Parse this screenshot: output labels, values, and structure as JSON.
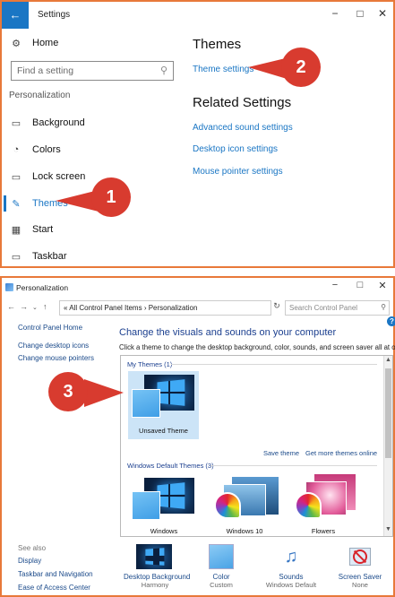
{
  "settings": {
    "title": "Settings",
    "back_glyph": "←",
    "controls": {
      "minimize": "−",
      "maximize": "□",
      "close": "✕"
    },
    "nav_home": "Home",
    "search_placeholder": "Find a setting",
    "section": "Personalization",
    "nav": [
      {
        "label": "Background",
        "icon": "image-icon"
      },
      {
        "label": "Colors",
        "icon": "palette-icon"
      },
      {
        "label": "Lock screen",
        "icon": "lock-screen-icon"
      },
      {
        "label": "Themes",
        "icon": "themes-icon"
      },
      {
        "label": "Start",
        "icon": "start-icon"
      },
      {
        "label": "Taskbar",
        "icon": "taskbar-icon"
      }
    ],
    "heading_themes": "Themes",
    "link_theme_settings": "Theme settings",
    "heading_related": "Related Settings",
    "related_links": [
      "Advanced sound settings",
      "Desktop icon settings",
      "Mouse pointer settings"
    ]
  },
  "callouts": [
    "1",
    "2",
    "3"
  ],
  "control_panel": {
    "title": "Personalization",
    "controls": {
      "minimize": "−",
      "maximize": "□",
      "close": "✕"
    },
    "address": "« All Control Panel Items  ›  Personalization",
    "search_placeholder": "Search Control Panel",
    "sidebar": [
      "Control Panel Home",
      "Change desktop icons",
      "Change mouse pointers"
    ],
    "see_also_label": "See also",
    "see_also": [
      "Display",
      "Taskbar and Navigation",
      "Ease of Access Center"
    ],
    "heading": "Change the visuals and sounds on your computer",
    "description": "Click a theme to change the desktop background, color, sounds, and screen saver all at once.",
    "group_my_themes": "My Themes (1)",
    "my_themes": [
      "Unsaved Theme"
    ],
    "save_theme": "Save theme",
    "get_more_themes": "Get more themes online",
    "group_default_themes": "Windows Default Themes (3)",
    "default_themes": [
      "Windows",
      "Windows 10",
      "Flowers"
    ],
    "bottom": [
      {
        "label": "Desktop Background",
        "sub": "Harmony"
      },
      {
        "label": "Color",
        "sub": "Custom"
      },
      {
        "label": "Sounds",
        "sub": "Windows Default"
      },
      {
        "label": "Screen Saver",
        "sub": "None"
      }
    ]
  },
  "colors": {
    "accent": "#1a76c4",
    "callout": "#d83b2f",
    "frame": "#e8793a"
  }
}
